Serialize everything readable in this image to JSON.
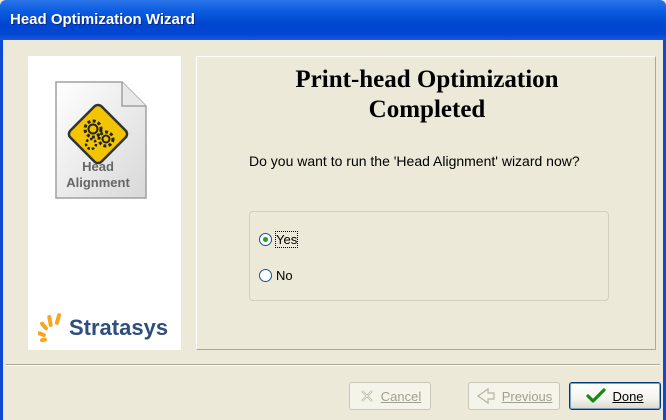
{
  "window": {
    "title": "Head Optimization Wizard"
  },
  "sidebar": {
    "icon_label_line1": "Head",
    "icon_label_line2": "Alignment",
    "brand_name": "Stratasys",
    "colors": {
      "brand_text": "#2E4E7E",
      "brand_burst": "#F5A623",
      "gear_bg": "#F2C500"
    }
  },
  "main": {
    "heading_line1": "Print-head Optimization",
    "heading_line2": "Completed",
    "question": "Do you want to run the 'Head Alignment' wizard now?",
    "options": [
      {
        "label": "Yes",
        "selected": true
      },
      {
        "label": "No",
        "selected": false
      }
    ]
  },
  "footer": {
    "cancel_label": "Cancel",
    "previous_label": "Previous",
    "done_label": "Done",
    "cancel_icon": "x-icon",
    "previous_icon": "arrow-left-icon",
    "done_icon": "checkmark-icon",
    "cancel_enabled": false,
    "previous_enabled": false,
    "done_enabled": true
  },
  "colors": {
    "titlebar": "#0046CF",
    "dialog_bg": "#ECE9D8",
    "radio_dot": "#21A121"
  }
}
